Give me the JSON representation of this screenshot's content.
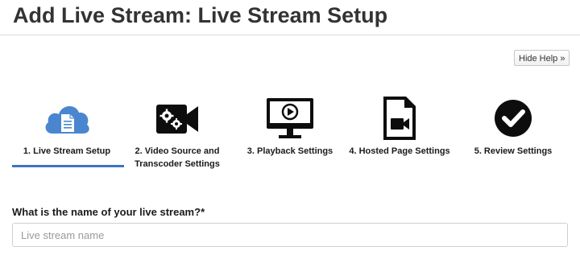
{
  "header": {
    "title": "Add Live Stream: Live Stream Setup"
  },
  "help": {
    "hide_label": "Hide Help »"
  },
  "wizard": {
    "steps": [
      {
        "label": "1. Live Stream Setup",
        "icon": "cloud-document-icon",
        "active": true
      },
      {
        "label": "2. Video Source and Transcoder Settings",
        "icon": "video-camera-gears-icon",
        "active": false
      },
      {
        "label": "3. Playback Settings",
        "icon": "monitor-play-icon",
        "active": false
      },
      {
        "label": "4. Hosted Page Settings",
        "icon": "video-file-icon",
        "active": false
      },
      {
        "label": "5. Review Settings",
        "icon": "check-circle-icon",
        "active": false
      }
    ],
    "active_color": "#3a76c4"
  },
  "form": {
    "name_label": "What is the name of your live stream?",
    "required_mark": "*",
    "name_placeholder": "Live stream name",
    "name_value": ""
  }
}
